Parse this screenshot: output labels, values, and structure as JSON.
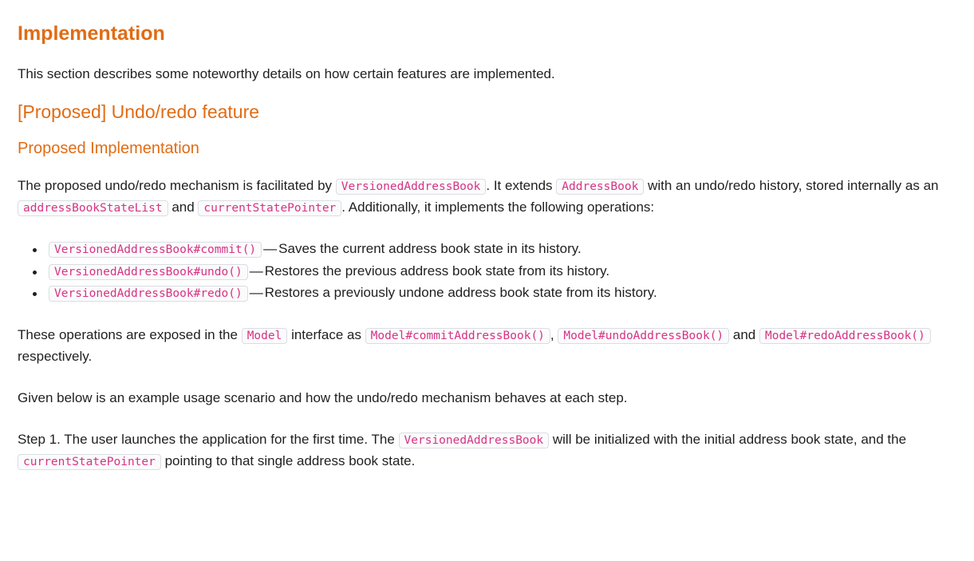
{
  "title": "Implementation",
  "intro": "This section describes some noteworthy details on how certain features are implemented.",
  "feature_heading": "[Proposed] Undo/redo feature",
  "sub_heading": "Proposed Implementation",
  "para1": {
    "t1": "The proposed undo/redo mechanism is facilitated by ",
    "c1": "VersionedAddressBook",
    "t2": ". It extends ",
    "c2": "AddressBook",
    "t3": " with an undo/redo history, stored internally as an ",
    "c3": "addressBookStateList",
    "t4": " and ",
    "c4": "currentStatePointer",
    "t5": ". Additionally, it implements the following operations:"
  },
  "operations": [
    {
      "code": "VersionedAddressBook#commit()",
      "dash": "—",
      "desc": "Saves the current address book state in its history."
    },
    {
      "code": "VersionedAddressBook#undo()",
      "dash": "—",
      "desc": "Restores the previous address book state from its history."
    },
    {
      "code": "VersionedAddressBook#redo()",
      "dash": "—",
      "desc": "Restores a previously undone address book state from its history."
    }
  ],
  "para2": {
    "t1": "These operations are exposed in the ",
    "c1": "Model",
    "t2": " interface as ",
    "c2": "Model#commitAddressBook()",
    "t3": ", ",
    "c3": "Model#undoAddressBook()",
    "t4": " and ",
    "c4": "Model#redoAddressBook()",
    "t5": " respectively."
  },
  "para3": "Given below is an example usage scenario and how the undo/redo mechanism behaves at each step.",
  "para4": {
    "t1": "Step 1. The user launches the application for the first time. The ",
    "c1": "VersionedAddressBook",
    "t2": " will be initialized with the initial address book state, and the ",
    "c2": "currentStatePointer",
    "t3": " pointing to that single address book state."
  },
  "colors": {
    "heading": "#e06c14",
    "code_text": "#d63384",
    "code_border": "#d9dde3",
    "body_text": "#1f1f1f"
  }
}
